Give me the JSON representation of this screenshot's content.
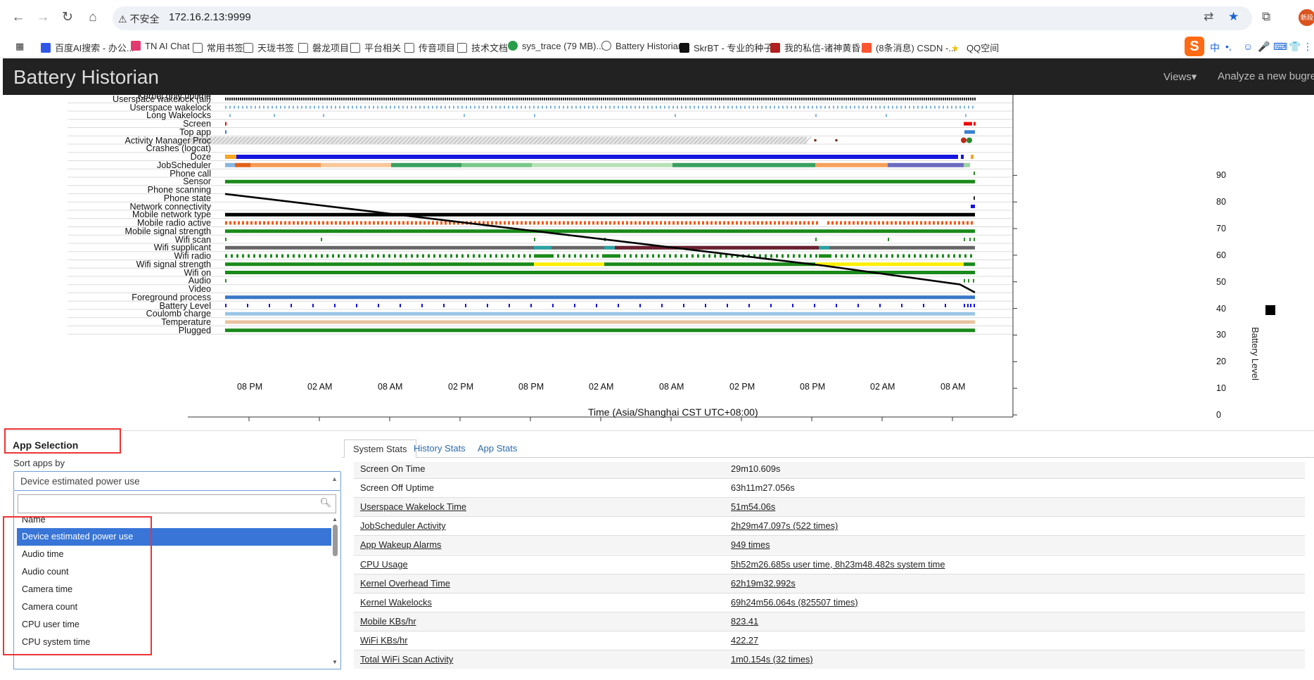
{
  "browser": {
    "security_warning": "不安全",
    "url": "172.16.2.13:9999",
    "avatar_text": "新段",
    "bookmarks": [
      {
        "label": "百度AI搜索 - 办公...",
        "icon": "baidu-icon"
      },
      {
        "label": "TN AI Chat",
        "icon": "tn-icon"
      },
      {
        "label": "常用书签",
        "icon": "folder-icon"
      },
      {
        "label": "天珑书签",
        "icon": "folder-icon"
      },
      {
        "label": "磐龙项目",
        "icon": "folder-icon"
      },
      {
        "label": "平台相关",
        "icon": "folder-icon"
      },
      {
        "label": "传音项目",
        "icon": "folder-icon"
      },
      {
        "label": "技术文档",
        "icon": "folder-icon"
      },
      {
        "label": "sys_trace (79 MB)...",
        "icon": "perfetto-icon"
      },
      {
        "label": "Battery Historian",
        "icon": "globe-icon"
      },
      {
        "label": "SkrBT - 专业的种子...",
        "icon": "skrbt-icon"
      },
      {
        "label": "我的私信-诸神黄昏...",
        "icon": "game-icon"
      },
      {
        "label": "(8条消息) CSDN -...",
        "icon": "csdn-icon"
      },
      {
        "label": "QQ空间",
        "icon": "star-icon"
      }
    ],
    "ime": {
      "lang": "中"
    }
  },
  "app": {
    "title": "Battery Historian",
    "views_menu": "Views▾",
    "analyze_link": "Analyze a new bugreport"
  },
  "timeline": {
    "clipped_top_label": "Kernel only uptime",
    "rows": [
      "Userspace wakelock (all)",
      "Userspace wakelock",
      "Long Wakelocks",
      "Screen",
      "Top app",
      "Activity Manager Proc",
      "Crashes (logcat)",
      "Doze",
      "JobScheduler",
      "Phone call",
      "Sensor",
      "Phone scanning",
      "Phone state",
      "Network connectivity",
      "Mobile network type",
      "Mobile radio active",
      "Mobile signal strength",
      "Wifi scan",
      "Wifi supplicant",
      "Wifi radio",
      "Wifi signal strength",
      "Wifi on",
      "Audio",
      "Video",
      "Foreground process",
      "Battery Level",
      "Coulomb charge",
      "Temperature",
      "Plugged"
    ],
    "x_ticks": [
      "08 PM",
      "02 AM",
      "08 AM",
      "02 PM",
      "08 PM",
      "02 AM",
      "08 AM",
      "02 PM",
      "08 PM",
      "02 AM",
      "08 AM"
    ],
    "x_axis_label": "Time (Asia/Shanghai CST UTC+08:00)",
    "y_axis_label": "Battery Level",
    "y_ticks": [
      90,
      80,
      70,
      60,
      50,
      40,
      30,
      20,
      10,
      0
    ],
    "colors": {
      "doze": "#1515e0",
      "sensor": "#1a8a1a",
      "mobile_radio": "#f05a1a",
      "wifi_weak": "#ffee00",
      "battery_line": "#000000"
    },
    "battery_series": {
      "x_fraction": [
        0,
        0.8,
        0.98,
        1.0
      ],
      "level": [
        83,
        56,
        49,
        46
      ]
    }
  },
  "app_selection": {
    "title": "App Selection",
    "sort_label": "Sort apps by",
    "selected": "Device estimated power use",
    "search_placeholder": "",
    "options": [
      "Name",
      "Device estimated power use",
      "Audio time",
      "Audio count",
      "Camera time",
      "Camera count",
      "CPU user time",
      "CPU system time"
    ],
    "highlighted_index": 1
  },
  "stats": {
    "tabs": [
      "System Stats",
      "History Stats",
      "App Stats"
    ],
    "active_tab": 0,
    "rows": [
      {
        "key": "Screen On Time",
        "value": "29m10.609s",
        "link": false
      },
      {
        "key": "Screen Off Uptime",
        "value": "63h11m27.056s",
        "link": false
      },
      {
        "key": "Userspace Wakelock Time",
        "value": "51m54.06s",
        "link": true
      },
      {
        "key": "JobScheduler Activity",
        "value": "2h29m47.097s (522 times)",
        "link": true
      },
      {
        "key": "App Wakeup Alarms",
        "value": "949 times",
        "link": true
      },
      {
        "key": "CPU Usage",
        "value": "5h52m26.685s user time, 8h23m48.482s system time",
        "link": true
      },
      {
        "key": "Kernel Overhead Time",
        "value": "62h19m32.992s",
        "link": true
      },
      {
        "key": "Kernel Wakelocks",
        "value": "69h24m56.064s (825507 times)",
        "link": true
      },
      {
        "key": "Mobile KBs/hr",
        "value": "823.41",
        "link": true
      },
      {
        "key": "WiFi KBs/hr",
        "value": "422.27",
        "link": true
      },
      {
        "key": "Total WiFi Scan Activity",
        "value": "1m0.154s (32 times)",
        "link": true
      }
    ]
  }
}
